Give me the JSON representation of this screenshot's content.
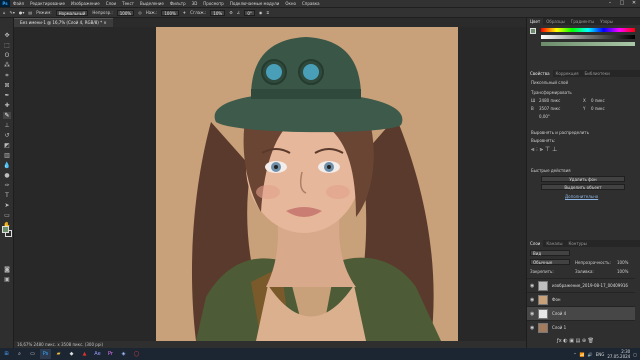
{
  "app": {
    "logo": "Ps"
  },
  "menu": [
    "Файл",
    "Редактирование",
    "Изображение",
    "Слои",
    "Текст",
    "Выделение",
    "Фильтр",
    "3D",
    "Просмотр",
    "Подключаемые модули",
    "Окно",
    "Справка"
  ],
  "options": {
    "mode_label": "Режим:",
    "mode_value": "Нормальный",
    "opacity_label": "Непрозр.:",
    "opacity_value": "100%",
    "flow_label": "Наж.:",
    "flow_value": "100%",
    "smooth_label": "Сглаж.:",
    "smooth_value": "10%",
    "angle_value": "0°"
  },
  "document": {
    "tab_title": "Без имени-1 @ 16,7% (Слой 4, RGB/8) *",
    "status": "16,67%    2480 пикс. x 3508 пикс. (300 ppi)"
  },
  "panels": {
    "color_tabs": [
      "Цвет",
      "Образцы",
      "Градиенты",
      "Узоры"
    ],
    "props_tabs": [
      "Свойства",
      "Коррекция",
      "Библиотеки"
    ],
    "props_layer_type": "Пиксельный слой",
    "transform_title": "Трансформировать",
    "w_label": "Ш",
    "w_value": "2480 пикс",
    "x_label": "X",
    "x_value": "0 пикс",
    "h_label": "В",
    "h_value": "3507 пикс",
    "y_label": "Y",
    "y_value": "0 пикс",
    "angle_value": "0,00°",
    "align_title": "Выровнять и распределить",
    "align_sub": "Выровнять:",
    "quick_title": "Быстрые действия",
    "quick_btn1": "Удалить фон",
    "quick_btn2": "Выделить объект",
    "quick_more": "Дополнительно",
    "layers_tabs": [
      "Слои",
      "Каналы",
      "Контуры"
    ],
    "layers_search": "Вид",
    "blend_mode": "Обычные",
    "opacity_label": "Непрозрачность:",
    "opacity_value": "100%",
    "lock_label": "Закрепить:",
    "fill_label": "Заливка:",
    "fill_value": "100%",
    "layers": [
      {
        "name": "изображение_2019-08-17_00409916",
        "selected": false
      },
      {
        "name": "Фон",
        "selected": false
      },
      {
        "name": "Слой 4",
        "selected": true
      },
      {
        "name": "Слой 1",
        "selected": false
      }
    ]
  },
  "taskbar": {
    "lang": "ENG",
    "time": "2:30",
    "date": "27.05.2024"
  }
}
